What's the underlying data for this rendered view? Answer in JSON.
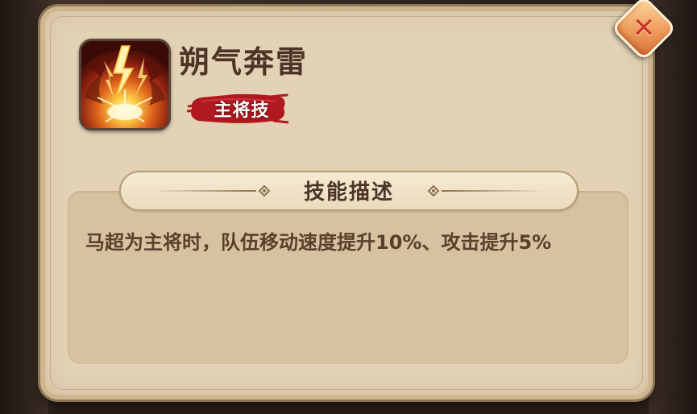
{
  "dialog": {
    "close_icon": "close-x-icon"
  },
  "skill": {
    "icon": "lightning-burst-icon",
    "name": "朔气奔雷",
    "tag": "主将技"
  },
  "section": {
    "title": "技能描述"
  },
  "description": {
    "text": "马超为主将时，队伍移动速度提升10%、攻击提升5%"
  },
  "colors": {
    "parchment": "#e3d2b5",
    "desc_box": "#d6c2a0",
    "title_text": "#4b3526",
    "tag_red": "#b1181f",
    "close_orange": "#f0a060"
  }
}
